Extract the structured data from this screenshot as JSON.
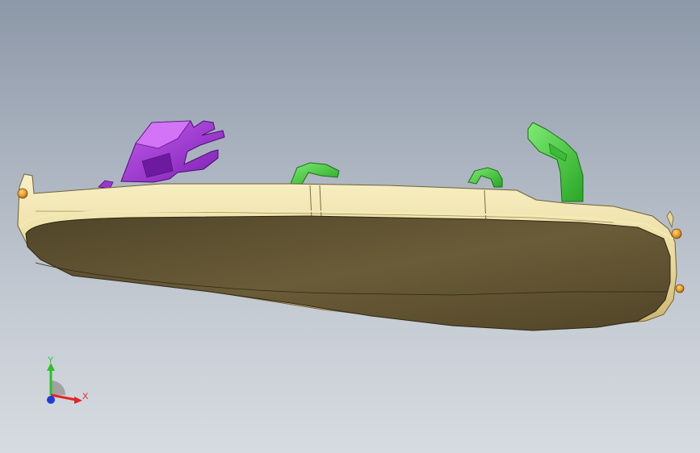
{
  "viewport": {
    "background_top": "#8d98a8",
    "background_bottom": "#d6dbe0"
  },
  "model": {
    "body_color": "#ecdfa6",
    "bottom_face_color": "#5e5335",
    "clip_purple_color": "#a53bd6",
    "clip_green_color": "#4cd646",
    "orange_marker_color": "#e39a2a"
  },
  "triad": {
    "y_label": "Y",
    "x_label": "X",
    "y_color": "#2bc22b",
    "x_color": "#e52424",
    "z_color": "#1f3ed6"
  }
}
